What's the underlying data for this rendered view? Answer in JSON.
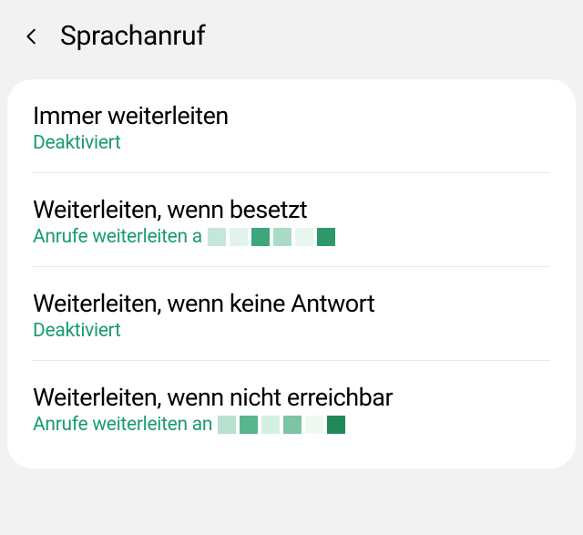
{
  "header": {
    "title": "Sprachanruf"
  },
  "items": [
    {
      "title": "Immer weiterleiten",
      "subtitle": "Deaktiviert",
      "redacted": false
    },
    {
      "title": "Weiterleiten, wenn besetzt",
      "subtitle": "Anrufe weiterleiten a",
      "redacted": true
    },
    {
      "title": "Weiterleiten, wenn keine Antwort",
      "subtitle": "Deaktiviert",
      "redacted": false
    },
    {
      "title": "Weiterleiten, wenn nicht erreichbar",
      "subtitle": "Anrufe weiterleiten an",
      "redacted": true
    }
  ]
}
